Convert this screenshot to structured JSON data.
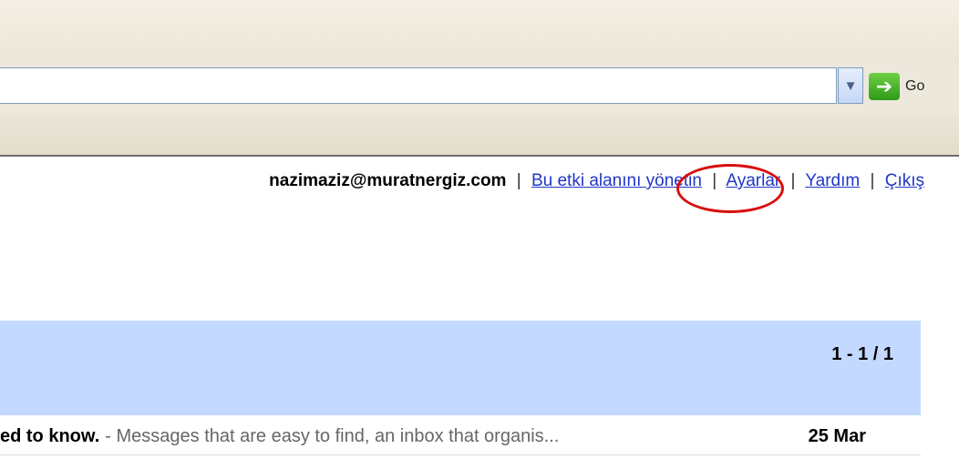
{
  "browser": {
    "address_value": "",
    "go_label": "Go",
    "dropdown_icon": "chevron-down-icon",
    "go_icon": "go-arrow-icon"
  },
  "header": {
    "email": "nazimaziz@muratnergiz.com",
    "separator": "|",
    "links": {
      "manage_domain": "Bu etki alanını yönetin",
      "settings": "Ayarlar",
      "help": "Yardım",
      "logout": "Çıkış"
    },
    "highlight_color": "#d90f0f"
  },
  "list": {
    "pager": "1 - 1 / 1",
    "header_color": "#c3d9ff",
    "messages": [
      {
        "subject": "ed to know.",
        "snippet": "- Messages that are easy to find, an inbox that organis...",
        "date": "25 Mar"
      }
    ]
  }
}
